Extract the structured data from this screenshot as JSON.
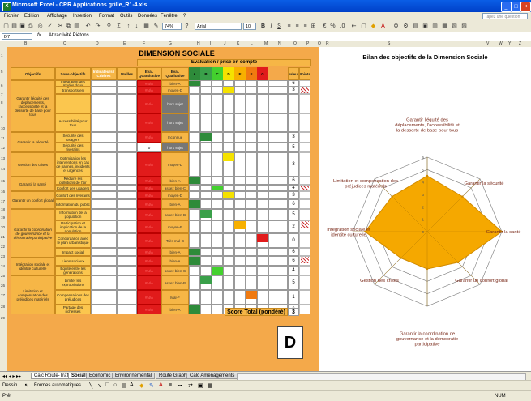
{
  "window": {
    "title": "Microsoft Excel - CRR Applications grille_R1-4.xls"
  },
  "menu": [
    "Fichier",
    "Edition",
    "Affichage",
    "Insertion",
    "Format",
    "Outils",
    "Données",
    "Fenêtre",
    "?"
  ],
  "toolbar": {
    "zoom": "74%",
    "font": "Arial",
    "size": "10",
    "help_placeholder": "Tapez une question"
  },
  "formula": {
    "namebox": "D7",
    "fx": "fx",
    "content": "Attractivité Piétons"
  },
  "columns": [
    "A",
    "B",
    "C",
    "D",
    "E",
    "F",
    "G",
    "H",
    "I",
    "J",
    "K",
    "L",
    "M",
    "N",
    "O",
    "P",
    "Q",
    "R",
    "S",
    "T",
    "U",
    "V",
    "W",
    "X",
    "Y",
    "Z",
    "AA"
  ],
  "sheet": {
    "title": "DIMENSION SOCIALE",
    "eval_header": "Evaluation / prise en compte",
    "headers": {
      "objectifs": "Objectifs",
      "sous": "Sous-objectifs",
      "indicateurs": "Indicateurs / Critères",
      "mailles": "Mailles",
      "quant": "Eval. Quantitative",
      "qual": "Eval. Qualitative",
      "a": "A",
      "b": "B",
      "c": "C",
      "d": "D",
      "e": "E",
      "f": "F",
      "g": "G",
      "valeur": "valeur",
      "points": "Points"
    },
    "objectives": [
      "Garantir l'équité des déplacements, l'accessibilité et la desserte de base pour tous",
      "Garantir la sécurité",
      "Gestion des crises",
      "Garantir la santé",
      "Garantir un confort global",
      "Garantir la coordination de gouvernance et la démocratie participative",
      "Intégration sociale et identité culturelle",
      "Limitation et compensation des préjudices matériels"
    ],
    "rows": [
      {
        "sub": "Intégration des modes doux",
        "quant": "#N/A",
        "qual": "bien-A",
        "valeur": "6"
      },
      {
        "sub": "Intégration des transports en commun",
        "quant": "#N/A",
        "qual": "moyen-D",
        "valeur": "3"
      },
      {
        "sub": "",
        "quant": "#N/A",
        "qual": "hors sujet",
        "valeur": ""
      },
      {
        "sub": "Accessibilité pour tous",
        "quant": "#N/A",
        "qual": "hors sujet",
        "valeur": ""
      },
      {
        "sub": "Sécurité des usagers",
        "quant": "#N/A",
        "qual": "Inconnue",
        "valeur": "3"
      },
      {
        "sub": "Sécurité des riverains",
        "quant": "0",
        "qual": "hors sujet",
        "valeur": "5"
      },
      {
        "sub": "Optimisation les interventions en cas de pannes, incidents et urgences",
        "quant": "#N/A",
        "qual": "moyen-D",
        "valeur": "3"
      },
      {
        "sub": "Réduire les pollutions de l'air",
        "quant": "#N/A",
        "qual": "bien-A",
        "valeur": "6"
      },
      {
        "sub": "Confort des usagers",
        "quant": "#N/A",
        "qual": "assez bien-C",
        "valeur": "4"
      },
      {
        "sub": "Confort des riverains",
        "quant": "#N/A",
        "qual": "moyen-D",
        "valeur": "3"
      },
      {
        "sub": "Information du public",
        "quant": "#N/A",
        "qual": "bien-A",
        "valeur": "6"
      },
      {
        "sub": "Information de la population",
        "quant": "#N/A",
        "qual": "assez bien-B",
        "valeur": "5"
      },
      {
        "sub": "Participation et implication de la population",
        "quant": "#N/A",
        "qual": "moyen-E",
        "valeur": "2"
      },
      {
        "sub": "Concordance avec le plan urbanistique",
        "quant": "#N/A",
        "qual": "Très mal-G",
        "valeur": "0"
      },
      {
        "sub": "Impact social",
        "quant": "#N/A",
        "qual": "bien-A",
        "valeur": "6"
      },
      {
        "sub": "Liens sociaux",
        "quant": "#N/A",
        "qual": "bien-A",
        "valeur": "6"
      },
      {
        "sub": "Equité entre les générations",
        "quant": "#N/A",
        "qual": "assez bien-C",
        "valeur": "4"
      },
      {
        "sub": "Limiter les expropriations",
        "quant": "#N/A",
        "qual": "assez bien-B",
        "valeur": "5"
      },
      {
        "sub": "Compensations des préjudices",
        "quant": "#N/A",
        "qual": "Mal-F",
        "valeur": "1"
      },
      {
        "sub": "Partage des richesses",
        "quant": "#N/A",
        "qual": "bien-A",
        "valeur": "6"
      }
    ],
    "score_label": "Score Total (pondéré)",
    "score_value": "3",
    "grade": "D"
  },
  "chart_data": {
    "type": "radar",
    "title": "Bilan des objectifs de la Dimension Sociale",
    "categories": [
      "Garantir l'équité des déplacements, l'accessibilité et la desserte de base pour tous",
      "Garantir la sécurité",
      "Garantir la santé",
      "Garantir un confort global",
      "Garantir la coordination de gouvernance et la démocratie participative",
      "Gestion des crises",
      "Intégration sociale et identité culturelle",
      "Limitation et compensation des préjudices matériels"
    ],
    "values": [
      4.5,
      4,
      6,
      3.5,
      3,
      3,
      5,
      4
    ],
    "rmax": 6,
    "ticks": [
      "0",
      "1",
      "2",
      "3",
      "4",
      "5",
      "6"
    ],
    "fill_color": "#f5a800",
    "line_color": "#d08a00"
  },
  "sheet_tabs": [
    "Calc Route-Traf",
    "Social",
    "Economic",
    "Environnemental",
    "Route Graph",
    "Calc Aménagements"
  ],
  "drawbar": {
    "dessin": "Dessin",
    "formes": "Formes automatiques"
  },
  "status": {
    "left": "Prêt",
    "right": "NUM"
  }
}
